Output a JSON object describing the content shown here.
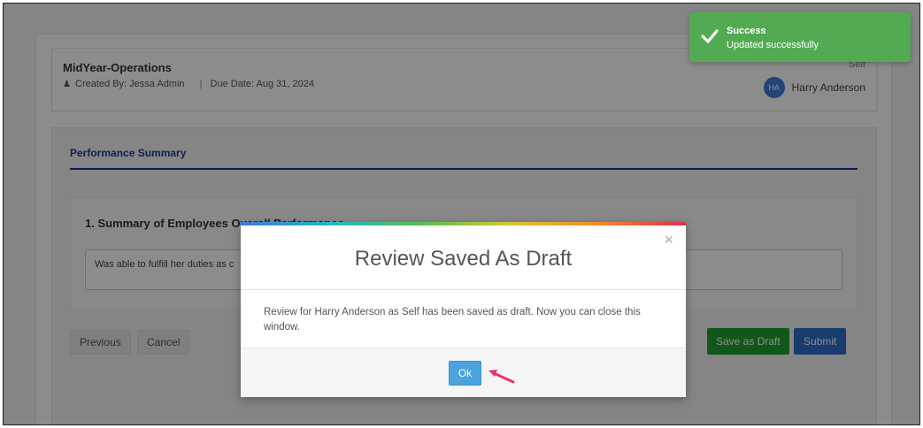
{
  "review": {
    "title": "MidYear-Operations",
    "created_by": "Created By: Jessa Admin",
    "separator": "|",
    "due_date": "Due Date: Aug 31, 2024",
    "self_tag": "Self",
    "assignee_initials": "HA",
    "assignee_name": "Harry Anderson"
  },
  "section": {
    "tab_label": "Performance Summary",
    "question_title": "1. Summary of Employees Overall Performance",
    "answer_text": "Was able to fulfill her duties as c"
  },
  "actions": {
    "previous": "Previous",
    "cancel": "Cancel",
    "save_draft": "Save as Draft",
    "submit": "Submit"
  },
  "modal": {
    "close_glyph": "×",
    "title": "Review Saved As Draft",
    "body": "Review for Harry Anderson as Self has been saved as draft. Now you can close this window.",
    "ok_label": "Ok"
  },
  "toast": {
    "title": "Success",
    "message": "Updated successfully"
  },
  "colors": {
    "toast_bg": "#52ab52",
    "ok_button": "#4aa3df",
    "submit_button": "#2d6ec9",
    "draft_button": "#1f9e2f",
    "pointer_arrow": "#e8336b"
  }
}
